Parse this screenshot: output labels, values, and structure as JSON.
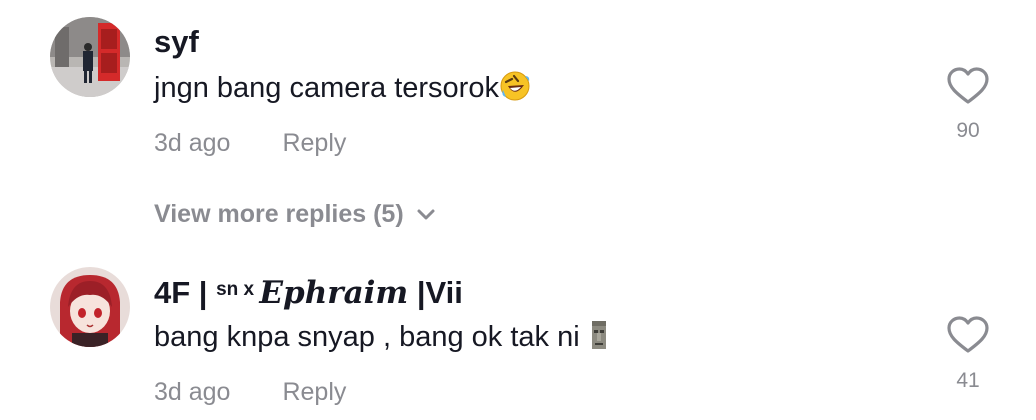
{
  "comments": [
    {
      "username": "syf",
      "text": "jngn bang camera tersorok",
      "text_emoji": "rolling-on-floor-laughing",
      "time": "3d ago",
      "reply_label": "Reply",
      "likes": "90",
      "avatar_icon": "phone-booth-photo"
    },
    {
      "username_part1": "4F | ",
      "username_part2": "sn",
      "username_part3": " x ",
      "username_part4": "Ephraim",
      "username_part5": " |Vii",
      "text": "bang knpa snyap , bang ok tak ni",
      "text_emoji": "moai",
      "time": "3d ago",
      "reply_label": "Reply",
      "likes": "41",
      "avatar_icon": "anime-girl-avatar"
    }
  ],
  "view_more": {
    "label": "View more replies (5)",
    "icon": "chevron-down-icon"
  },
  "colors": {
    "text": "#161823",
    "muted": "#8a8b91"
  }
}
